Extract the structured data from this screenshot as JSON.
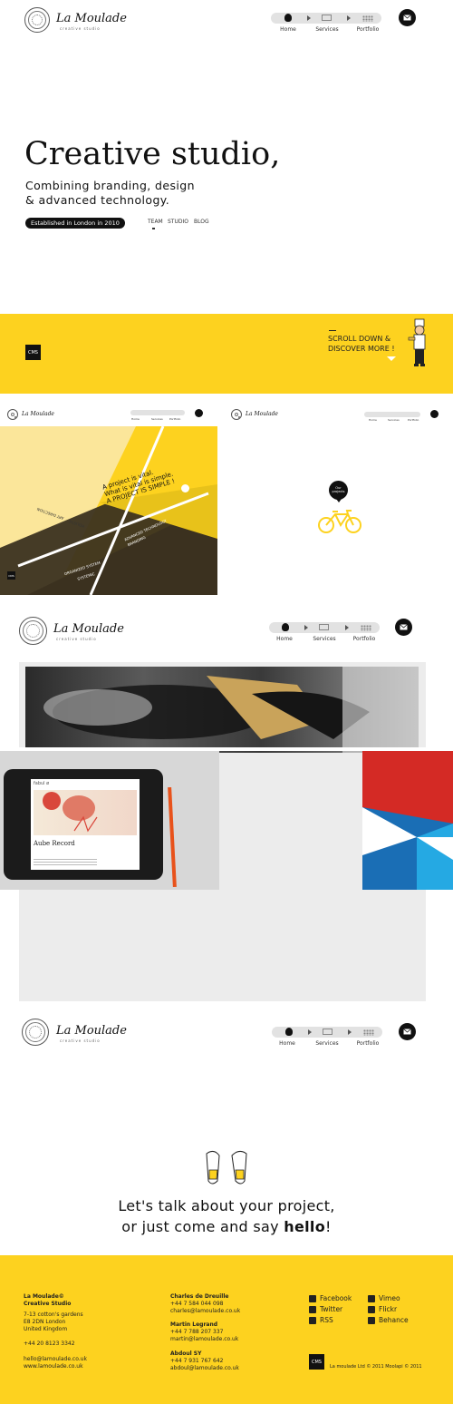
{
  "brand": {
    "name": "La Moulade",
    "tagline": "creative studio"
  },
  "nav": {
    "items": [
      "Home",
      "Services",
      "Portfolio"
    ],
    "mail_icon": "mail-icon"
  },
  "hero": {
    "title": "Creative studio,",
    "line1": "Combining branding, design",
    "line2": "& advanced technology.",
    "established": "Established in London in 2010",
    "links": [
      "TEAM",
      "STUDIO",
      "BLOG"
    ]
  },
  "band": {
    "cms": "CMS",
    "scroll_line1": "SCROLL DOWN &",
    "scroll_line2": "DISCOVER MORE !"
  },
  "studio_panel": {
    "quote1": "A project is vital.",
    "quote2": "What is vital is simple.",
    "quote3": "A PROJECT IS SIMPLE !",
    "label_art": "ART DIRECTION",
    "label_holistic": "HOLISTIC",
    "label_tech": "ADVANCED TECHNOLOGY",
    "label_branding": "BRANDING",
    "label_organized": "ORGANIZED SYSTEM",
    "label_systemic": "SYSTEMIC",
    "cms": "CMS"
  },
  "projects_panel": {
    "badge_line1": "Our",
    "badge_line2": "projects"
  },
  "portfolio": {
    "tablet_title": "Aube Record",
    "tablet_logo": "fabul ø"
  },
  "contact": {
    "line1": "Let's talk about your project,",
    "line2_prefix": "or just come and say ",
    "line2_bold": "hello",
    "line2_suffix": "!"
  },
  "footer": {
    "company": [
      "La Moulade©",
      "Creative Studio"
    ],
    "address": [
      "7-13 cotton's gardens",
      "E8 2DN London",
      "United Kingdom"
    ],
    "phone": "+44 20 8123 3342",
    "emails": [
      "hello@lamoulade.co.uk",
      "www.lamoulade.co.uk"
    ],
    "people": [
      {
        "name": "Charles de Dreuille",
        "phone": "+44 7 584 044 098",
        "email": "charles@lamoulade.co.uk"
      },
      {
        "name": "Martin Legrand",
        "phone": "+44 7 788 207 337",
        "email": "martin@lamoulade.co.uk"
      },
      {
        "name": "Abdoul SY",
        "phone": "+44 7 931 767 642",
        "email": "abdoul@lamoulade.co.uk"
      }
    ],
    "social_left": [
      "Facebook",
      "Twitter",
      "RSS"
    ],
    "social_right": [
      "Vimeo",
      "Flickr",
      "Behance"
    ],
    "cms": "CMS",
    "copyright": "La moulade Ltd © 2011 Moolapi © 2011"
  },
  "colors": {
    "yellow": "#fdd21f",
    "dark": "#3b3220",
    "red": "#d42a25",
    "blue": "#1a6eb5",
    "cyan": "#25a9e3"
  }
}
